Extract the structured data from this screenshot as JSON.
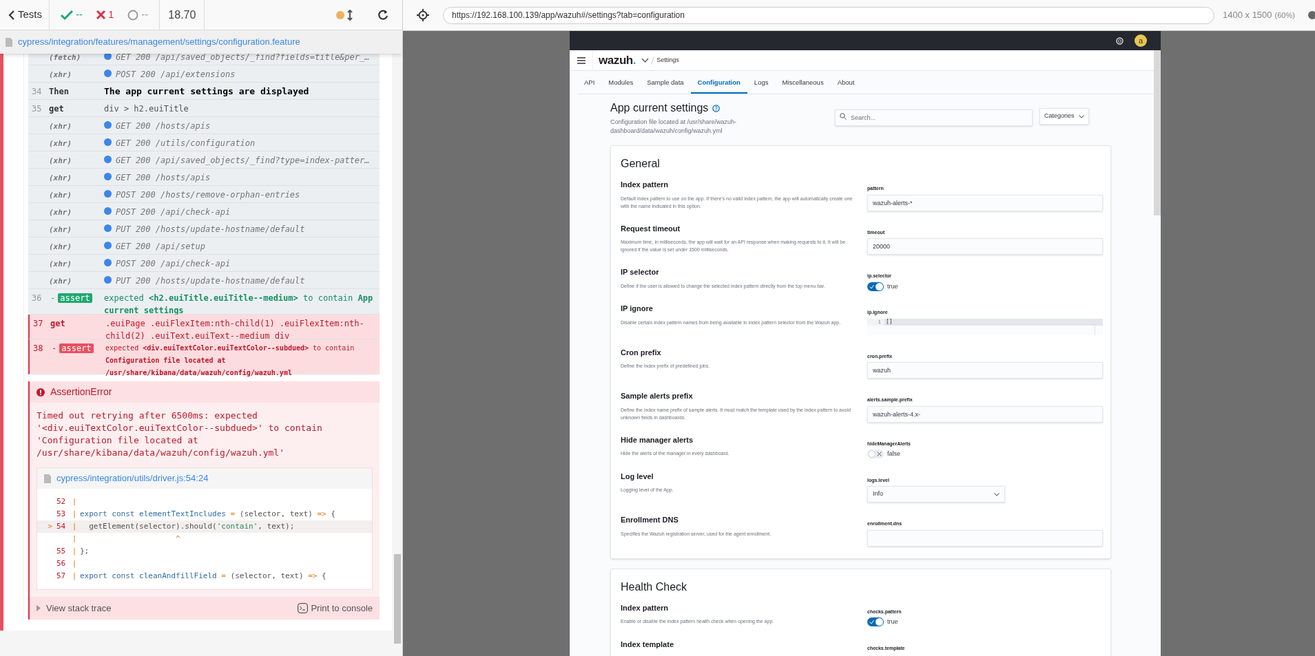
{
  "runner": {
    "back": "Tests",
    "passed": "--",
    "failed": "1",
    "pending": "--",
    "duration": "18.70",
    "spec_path": "cypress/integration/features/management/settings/configuration.feature"
  },
  "commands": [
    {
      "kind": "request",
      "name": "(fetch)",
      "message": "GET 200 /api/saved_objects/_find?fields=title&per_…",
      "failed": false
    },
    {
      "kind": "request",
      "name": "(xhr)",
      "message": "POST 200 /api/extensions",
      "failed": false
    },
    {
      "kind": "step",
      "number": "34",
      "name": "Then",
      "message": "The app current settings are displayed",
      "failed": false
    },
    {
      "kind": "command",
      "number": "35",
      "name": "get",
      "message": "div > h2.euiTitle",
      "failed": false
    },
    {
      "kind": "request",
      "name": "(xhr)",
      "message": "GET 200 /hosts/apis",
      "failed": false
    },
    {
      "kind": "request",
      "name": "(xhr)",
      "message": "GET 200 /utils/configuration",
      "failed": false
    },
    {
      "kind": "request",
      "name": "(xhr)",
      "message": "GET 200 /api/saved_objects/_find?type=index-patter…",
      "failed": false
    },
    {
      "kind": "request",
      "name": "(xhr)",
      "message": "GET 200 /hosts/apis",
      "failed": false
    },
    {
      "kind": "request",
      "name": "(xhr)",
      "message": "POST 200 /hosts/remove-orphan-entries",
      "failed": false
    },
    {
      "kind": "request",
      "name": "(xhr)",
      "message": "POST 200 /api/check-api",
      "failed": false
    },
    {
      "kind": "request",
      "name": "(xhr)",
      "message": "PUT 200 /hosts/update-hostname/default",
      "failed": false
    },
    {
      "kind": "request",
      "name": "(xhr)",
      "message": "GET 200 /api/setup",
      "failed": false
    },
    {
      "kind": "request",
      "name": "(xhr)",
      "message": "POST 200 /api/check-api",
      "failed": false
    },
    {
      "kind": "request",
      "name": "(xhr)",
      "message": "PUT 200 /hosts/update-hostname/default",
      "failed": false
    },
    {
      "kind": "assert",
      "number": "36",
      "dash": "-",
      "name": "assert",
      "message": "expected **<h2.euiTitle.euiTitle--medium>** to contain **App current settings**",
      "failed": false
    },
    {
      "kind": "command",
      "number": "37",
      "name": "get",
      "message": ".euiPage .euiFlexItem:nth-child(1) .euiFlexItem:nth-child(2) .euiText.euiText--medium div",
      "failed": true
    },
    {
      "kind": "assert",
      "number": "38",
      "dash": "-",
      "name": "assert",
      "message": "expected **<div.euiTextColor.euiTextColor--subdued>** to contain **Configuration file located at /usr/share/kibana/data/wazuh/config/wazuh.yml**",
      "failed": true
    }
  ],
  "error": {
    "title": "AssertionError",
    "message": "Timed out retrying after 6500ms: expected '<div.euiTextColor.euiTextColor--subdued>' to contain 'Configuration file located at /usr/share/kibana/data/wazuh/config/wazuh.yml'",
    "file": "cypress/integration/utils/driver.js:54:24",
    "code": [
      {
        "number": "52",
        "sep": "|",
        "current": false
      },
      {
        "number": "53",
        "sep": "|",
        "current": false,
        "tokens": [
          {
            "text": "export const ",
            "kind": "keyword"
          },
          {
            "text": "elementTextIncludes ",
            "kind": "name"
          },
          {
            "text": "= ",
            "kind": "operator"
          },
          {
            "text": "(selector, text) ",
            "kind": "plain"
          },
          {
            "text": "=> ",
            "kind": "operator"
          },
          {
            "text": "{",
            "kind": "plain"
          }
        ]
      },
      {
        "marker": ">",
        "number": "54",
        "sep": "|",
        "current": true,
        "tokens": [
          {
            "text": "  getElement(selector).should(",
            "kind": "plain"
          },
          {
            "text": "'contain'",
            "kind": "string"
          },
          {
            "text": ", text);",
            "kind": "plain"
          }
        ]
      },
      {
        "sep": "|",
        "current": false,
        "tokens": [
          {
            "text": "                     ^",
            "kind": "operator"
          }
        ]
      },
      {
        "number": "55",
        "sep": "|",
        "current": false,
        "tokens": [
          {
            "text": "};",
            "kind": "plain"
          }
        ]
      },
      {
        "number": "56",
        "sep": "|",
        "current": false
      },
      {
        "number": "57",
        "sep": "|",
        "current": false,
        "tokens": [
          {
            "text": "export const ",
            "kind": "keyword"
          },
          {
            "text": "cleanAndfillField ",
            "kind": "name"
          },
          {
            "text": "= ",
            "kind": "operator"
          },
          {
            "text": "(selector, text) ",
            "kind": "plain"
          },
          {
            "text": "=> ",
            "kind": "operator"
          },
          {
            "text": "{",
            "kind": "plain"
          }
        ]
      }
    ],
    "stack_trace": "View stack trace",
    "print": "Print to console"
  },
  "preview": {
    "url": "https://192.168.100.139/app/wazuh#/settings?tab=configuration",
    "size": "1400 x 1500",
    "scale": "(60%)"
  },
  "app": {
    "avatar": "a",
    "logo": "wazuh",
    "logo_dot": ".",
    "breadcrumb": "Settings",
    "tabs": [
      {
        "label": "API",
        "selected": false
      },
      {
        "label": "Modules",
        "selected": false
      },
      {
        "label": "Sample data",
        "selected": false
      },
      {
        "label": "Configuration",
        "selected": true
      },
      {
        "label": "Logs",
        "selected": false
      },
      {
        "label": "Miscellaneous",
        "selected": false
      },
      {
        "label": "About",
        "selected": false
      }
    ],
    "title": "App current settings",
    "subtitle": "Configuration file located at /usr/share/wazuh-dashboard/data/wazuh/config/wazuh.yml",
    "search_placeholder": "Search...",
    "categories": "Categories",
    "sections": [
      {
        "title": "General",
        "settings": [
          {
            "title": "Index pattern",
            "description": "Default index pattern to use on the app. If there's no valid index pattern, the app will automatically create one with the name indicated in this option.",
            "label": "pattern",
            "kind": "text",
            "value": "wazuh-alerts-*"
          },
          {
            "title": "Request timeout",
            "description": "Maximum time, in milliseconds, the app will wait for an API response when making requests to it. It will be ignored if the value is set under 1500 milliseconds.",
            "label": "timeout",
            "kind": "text",
            "value": "20000"
          },
          {
            "title": "IP selector",
            "description": "Define if the user is allowed to change the selected index pattern directly from the top menu bar.",
            "label": "ip.selector",
            "kind": "toggle",
            "on": true,
            "value": "true"
          },
          {
            "title": "IP ignore",
            "description": "Disable certain index pattern names from being available in index pattern selector from the Wazuh app.",
            "label": "ip.ignore",
            "kind": "editor",
            "line": "1",
            "value": "[]"
          },
          {
            "title": "Cron prefix",
            "description": "Define the index prefix of predefined jobs.",
            "label": "cron.prefix",
            "kind": "text",
            "value": "wazuh"
          },
          {
            "title": "Sample alerts prefix",
            "description": "Define the index name prefix of sample alerts. It must match the template used by the index pattern to avoid unknown fields in dashboards.",
            "label": "alerts.sample.prefix",
            "kind": "text",
            "value": "wazuh-alerts-4.x-"
          },
          {
            "title": "Hide manager alerts",
            "description": "Hide the alerts of the manager in every dashboard.",
            "label": "hideManagerAlerts",
            "kind": "toggle",
            "on": false,
            "value": "false"
          },
          {
            "title": "Log level",
            "description": "Logging level of the App.",
            "label": "logs.level",
            "kind": "select",
            "value": "Info"
          },
          {
            "title": "Enrollment DNS",
            "description": "Specifies the Wazuh registration server, used for the agent enrollment.",
            "label": "enrollment.dns",
            "kind": "text"
          }
        ]
      },
      {
        "title": "Health Check",
        "settings": [
          {
            "title": "Index pattern",
            "description": "Enable or disable the index pattern health check when opening the app.",
            "label": "checks.pattern",
            "kind": "toggle",
            "on": true,
            "value": "true"
          },
          {
            "title": "Index template",
            "label": "checks.template",
            "kind": "none"
          }
        ]
      }
    ]
  }
}
